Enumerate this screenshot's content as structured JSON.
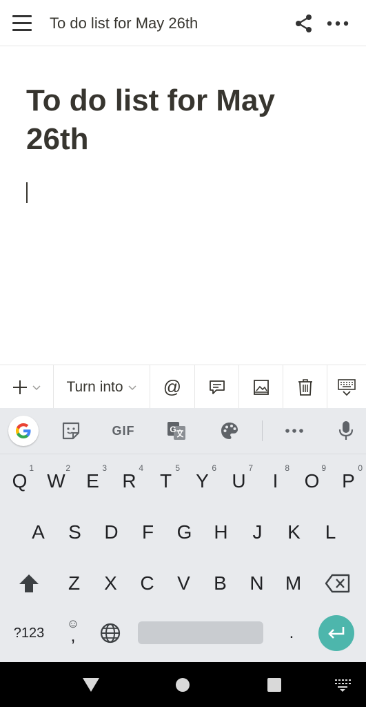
{
  "appbar": {
    "title": "To do list for May 26th"
  },
  "page": {
    "title": "To do list for May 26th"
  },
  "toolbar": {
    "turn_into_label": "Turn into",
    "mention_label": "@"
  },
  "keyboard": {
    "gif_label": "GIF",
    "row1": [
      {
        "key": "Q",
        "hint": "1"
      },
      {
        "key": "W",
        "hint": "2"
      },
      {
        "key": "E",
        "hint": "3"
      },
      {
        "key": "R",
        "hint": "4"
      },
      {
        "key": "T",
        "hint": "5"
      },
      {
        "key": "Y",
        "hint": "6"
      },
      {
        "key": "U",
        "hint": "7"
      },
      {
        "key": "I",
        "hint": "8"
      },
      {
        "key": "O",
        "hint": "9"
      },
      {
        "key": "P",
        "hint": "0"
      }
    ],
    "row2": [
      "A",
      "S",
      "D",
      "F",
      "G",
      "H",
      "J",
      "K",
      "L"
    ],
    "row3": [
      "Z",
      "X",
      "C",
      "V",
      "B",
      "N",
      "M"
    ],
    "symbols_label": "?123",
    "comma_label": ",",
    "emoji_label": "☺",
    "period_label": "."
  },
  "colors": {
    "accent": "#4db6ac",
    "keyboard_bg": "#e8eaed",
    "text": "#37352f"
  },
  "icons": [
    "menu-icon",
    "share-icon",
    "more-icon",
    "plus-icon",
    "comment-icon",
    "image-icon",
    "trash-icon",
    "keyboard-hide-icon",
    "google-icon",
    "sticker-icon",
    "translate-icon",
    "palette-icon",
    "mic-icon",
    "shift-icon",
    "backspace-icon",
    "globe-icon",
    "enter-icon",
    "nav-back-icon",
    "nav-home-icon",
    "nav-recents-icon",
    "nav-keyboard-icon"
  ]
}
